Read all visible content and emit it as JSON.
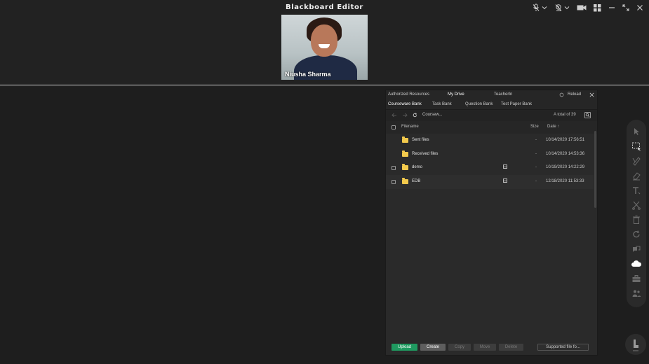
{
  "window": {
    "title": "Blackboard Editor"
  },
  "top_icons": [
    "mic-muted-icon",
    "chevron-down-icon",
    "camera-icon",
    "chevron-down-icon",
    "video-icon",
    "grid-icon",
    "minimize-icon",
    "maximize-icon",
    "close-icon"
  ],
  "video": {
    "participant_name": "Niusha Sharma"
  },
  "panel": {
    "tabs": [
      {
        "label": "Authorized Resources"
      },
      {
        "label": "My Drive"
      },
      {
        "label": "TeacherIn"
      }
    ],
    "reload_label": "Reload",
    "subtabs": [
      {
        "label": "Courseware Bank"
      },
      {
        "label": "Task Bank"
      },
      {
        "label": "Question Bank"
      },
      {
        "label": "Test Paper Bank"
      }
    ],
    "path": "Coursew...",
    "total": "A total of 39",
    "columns": {
      "filename": "Filename",
      "size": "Size",
      "date": "Date ↑"
    },
    "rows": [
      {
        "name": "Sent files",
        "size": "-",
        "date": "10/14/2020 17:56:51"
      },
      {
        "name": "Received files",
        "size": "-",
        "date": "10/14/2020 14:53:36"
      },
      {
        "name": "demo",
        "size": "-",
        "date": "10/19/2020 14:22:29"
      },
      {
        "name": "EDB",
        "size": "-",
        "date": "12/18/2020 11:53:33"
      }
    ],
    "buttons": {
      "upload": "Upload",
      "create": "Create",
      "copy": "Copy",
      "move": "Move",
      "delete": "Delete",
      "supported": "Supported file fo..."
    }
  },
  "toolbar": {
    "tools": [
      "pointer-icon",
      "selection-icon",
      "pen-icon",
      "eraser-icon",
      "text-icon",
      "scissors-icon",
      "trash-icon",
      "refresh-icon",
      "chat-icon",
      "cloud-icon",
      "toolbox-icon",
      "people-icon"
    ],
    "active": "cloud-icon"
  },
  "colors": {
    "accent_green": "#1f9a60",
    "folder_yellow": "#f2c94c",
    "background": "#1e1e1e"
  }
}
